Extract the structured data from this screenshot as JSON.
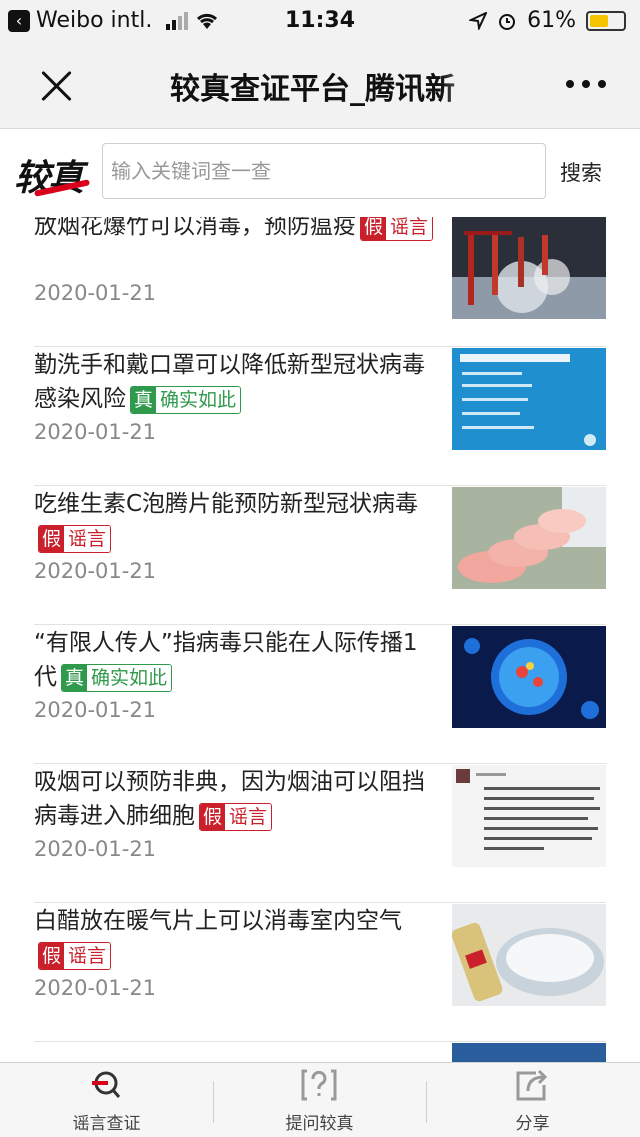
{
  "status_bar": {
    "back_app": "Weibo intl.",
    "time": "11:34",
    "battery_percent": 61
  },
  "nav": {
    "title": "较真查证平台_腾讯新"
  },
  "search": {
    "logo_text": "较真",
    "placeholder": "输入关键词查一查",
    "button_label": "搜索"
  },
  "articles": [
    {
      "title": "放烟花爆竹可以消毒，预防瘟疫",
      "badge_key": "假",
      "badge_text": "谣言",
      "verdict": "false",
      "date": "2020-01-21"
    },
    {
      "title": "勤洗手和戴口罩可以降低新型冠状病毒感染风险",
      "badge_key": "真",
      "badge_text": "确实如此",
      "verdict": "true",
      "date": "2020-01-21"
    },
    {
      "title": "吃维生素C泡腾片能预防新型冠状病毒",
      "badge_key": "假",
      "badge_text": "谣言",
      "verdict": "false",
      "date": "2020-01-21"
    },
    {
      "title": "“有限人传人”指病毒只能在人际传播1代",
      "badge_key": "真",
      "badge_text": "确实如此",
      "verdict": "true",
      "date": "2020-01-21"
    },
    {
      "title": "吸烟可以预防非典，因为烟油可以阻挡病毒进入肺细胞",
      "badge_key": "假",
      "badge_text": "谣言",
      "verdict": "false",
      "date": "2020-01-21"
    },
    {
      "title": "白醋放在暖气片上可以消毒室内空气",
      "badge_key": "假",
      "badge_text": "谣言",
      "verdict": "false",
      "date": "2020-01-21"
    }
  ],
  "tabs": [
    {
      "label": "谣言查证",
      "icon": "magnifier-icon"
    },
    {
      "label": "提问较真",
      "icon": "question-box-icon"
    },
    {
      "label": "分享",
      "icon": "share-icon"
    }
  ],
  "colors": {
    "fake": "#c9202b",
    "true": "#2f9a4b",
    "battery": "#f5c400"
  }
}
